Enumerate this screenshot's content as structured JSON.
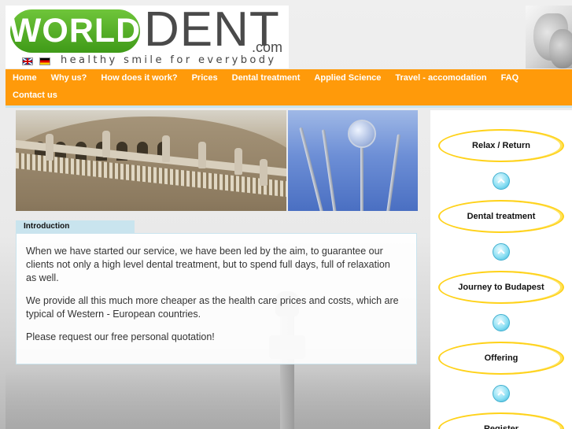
{
  "header": {
    "logo_world": "WORLD",
    "logo_dent": "DENT",
    "logo_dotcom": ".com",
    "tagline": "healthy smile for everybody"
  },
  "nav": {
    "items": [
      {
        "label": "Home"
      },
      {
        "label": "Why us?"
      },
      {
        "label": "How does it work?"
      },
      {
        "label": "Prices"
      },
      {
        "label": "Dental treatment"
      },
      {
        "label": "Applied Science"
      },
      {
        "label": "Travel - accomodation"
      },
      {
        "label": "FAQ"
      },
      {
        "label": "Contact us"
      }
    ]
  },
  "intro": {
    "tab_label": "Introduction",
    "paragraphs": [
      "When we have started our service, we have been led by the aim, to guarantee our clients not only a high level dental treatment, but to spend full days, full of relaxation as well.",
      "We provide all this much more cheaper as the health care prices and costs, which are typical of Western - European countries.",
      "Please request our free personal quotation!"
    ]
  },
  "sidebar": {
    "buttons": [
      {
        "label": "Relax / Return"
      },
      {
        "label": "Dental treatment"
      },
      {
        "label": "Journey to Budapest"
      },
      {
        "label": "Offering"
      },
      {
        "label": "Register"
      }
    ]
  },
  "colors": {
    "nav_bg": "#ff9a0a",
    "tab_bg": "#c9e4ee",
    "button_border": "#ffd21a",
    "logo_green": "#4faf22"
  }
}
